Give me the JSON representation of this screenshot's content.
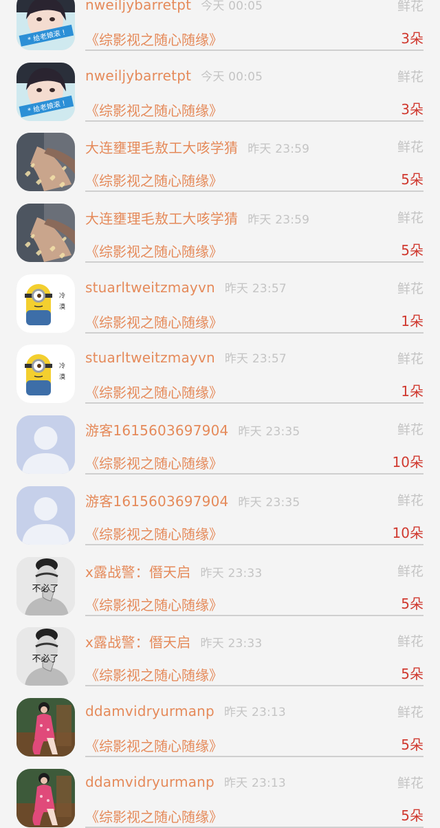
{
  "records": [
    {
      "user": "nweiljybarretpt",
      "time": "今天 00:05",
      "gift": "鲜花",
      "room": "《综影视之随心随缘》",
      "count": "3朵",
      "avatar": "girl-sticker"
    },
    {
      "user": "nweiljybarretpt",
      "time": "今天 00:05",
      "gift": "鲜花",
      "room": "《综影视之随心随缘》",
      "count": "3朵",
      "avatar": "girl-sticker"
    },
    {
      "user": "大连壅理毛敖工大咳学猜",
      "time": "昨天 23:59",
      "gift": "鲜花",
      "room": "《综影视之随心随缘》",
      "count": "5朵",
      "avatar": "hearts-photo"
    },
    {
      "user": "大连壅理毛敖工大咳学猜",
      "time": "昨天 23:59",
      "gift": "鲜花",
      "room": "《综影视之随心随缘》",
      "count": "5朵",
      "avatar": "hearts-photo"
    },
    {
      "user": "stuarltweitzmayvn",
      "time": "昨天 23:57",
      "gift": "鲜花",
      "room": "《综影视之随心随缘》",
      "count": "1朵",
      "avatar": "minion"
    },
    {
      "user": "stuarltweitzmayvn",
      "time": "昨天 23:57",
      "gift": "鲜花",
      "room": "《综影视之随心随缘》",
      "count": "1朵",
      "avatar": "minion"
    },
    {
      "user": "游客1615603697904",
      "time": "昨天 23:35",
      "gift": "鲜花",
      "room": "《综影视之随心随缘》",
      "count": "10朵",
      "avatar": "default-user"
    },
    {
      "user": "游客1615603697904",
      "time": "昨天 23:35",
      "gift": "鲜花",
      "room": "《综影视之随心随缘》",
      "count": "10朵",
      "avatar": "default-user"
    },
    {
      "user": "x露战警：僭天启",
      "time": "昨天 23:33",
      "gift": "鲜花",
      "room": "《综影视之随心随缘》",
      "count": "5朵",
      "avatar": "bw-portrait"
    },
    {
      "user": "x露战警：僭天启",
      "time": "昨天 23:33",
      "gift": "鲜花",
      "room": "《综影视之随心随缘》",
      "count": "5朵",
      "avatar": "bw-portrait"
    },
    {
      "user": "ddamvidryurmanp",
      "time": "昨天 23:13",
      "gift": "鲜花",
      "room": "《综影视之随心随缘》",
      "count": "5朵",
      "avatar": "woman-red-dress"
    },
    {
      "user": "ddamvidryurmanp",
      "time": "昨天 23:13",
      "gift": "鲜花",
      "room": "《综影视之随心随缘》",
      "count": "5朵",
      "avatar": "woman-red-dress"
    }
  ],
  "avatar_text": {
    "girl-sticker": "* 给老娘滚 !",
    "minion": "冷漠",
    "bw-portrait": "不必了"
  },
  "colors": {
    "name": "#e58a5a",
    "time": "#c4c4c4",
    "count": "#d0392f",
    "divider": "#cfcfcf",
    "background": "#f4f4f4"
  }
}
